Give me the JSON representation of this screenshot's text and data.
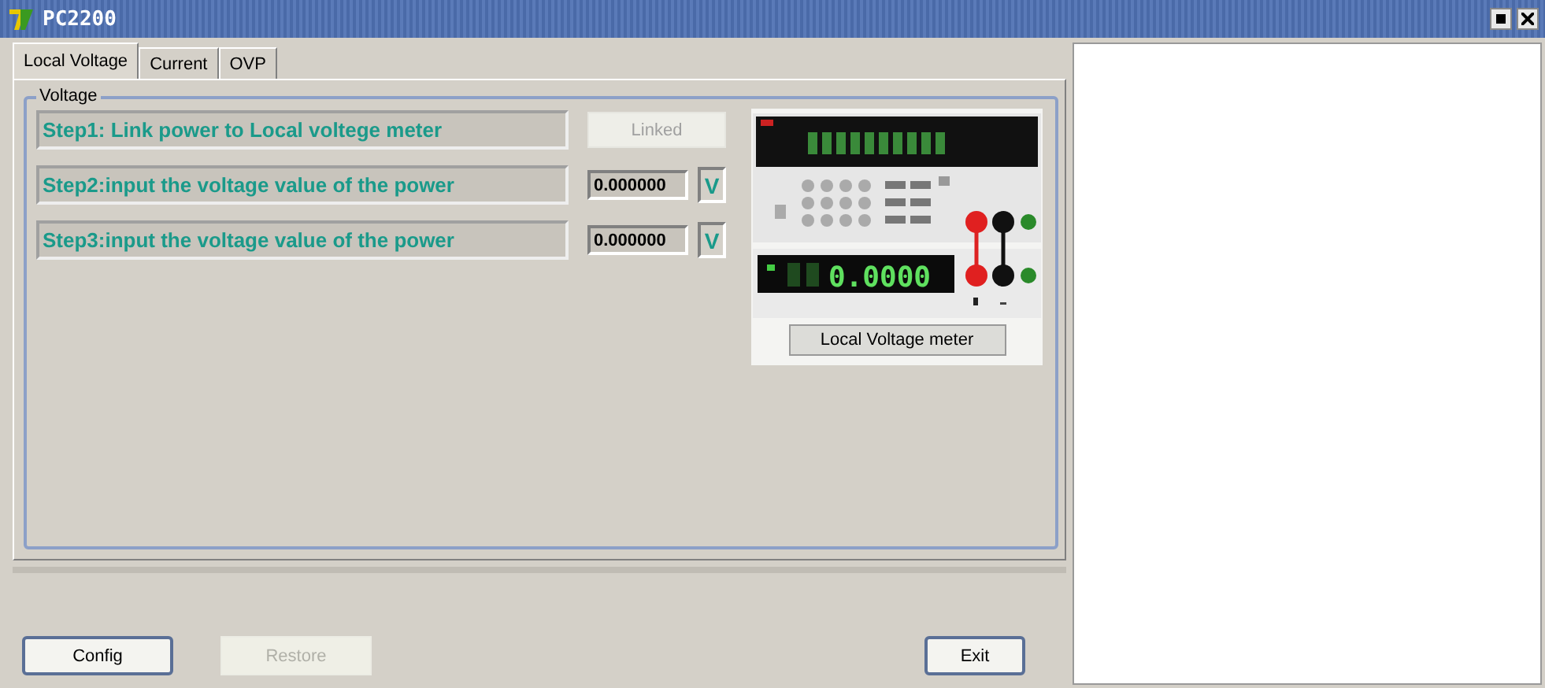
{
  "window": {
    "title": "PC2200"
  },
  "tabs": [
    {
      "label": "Local Voltage",
      "selected": true
    },
    {
      "label": "Current",
      "selected": false
    },
    {
      "label": "OVP",
      "selected": false
    }
  ],
  "group": {
    "title": "Voltage",
    "steps": [
      {
        "kind": "button",
        "label": "Step1: Link power to Local voltege meter",
        "action": "Linked",
        "disabled": true
      },
      {
        "kind": "input",
        "label": "Step2:input the voltage value of the power",
        "value": "0.000000",
        "unit": "V"
      },
      {
        "kind": "input",
        "label": "Step3:input the voltage value of the power",
        "value": "0.000000",
        "unit": "V"
      }
    ]
  },
  "meter": {
    "reading": "0.0000",
    "button": "Local Voltage meter"
  },
  "buttons": [
    {
      "label": "Config",
      "disabled": false
    },
    {
      "label": "Restore",
      "disabled": true
    },
    {
      "label": "Exit",
      "disabled": false
    }
  ]
}
